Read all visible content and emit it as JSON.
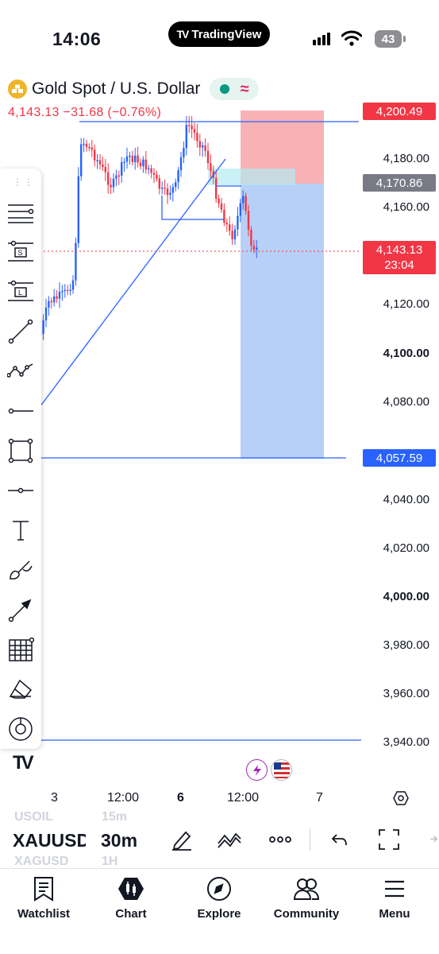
{
  "status_bar": {
    "time": "14:06",
    "app_pill": "TradingView",
    "battery": "43"
  },
  "symbol": {
    "name": "Gold Spot / U.S. Dollar",
    "price_change": "4,143.13  −31.68 (−0.76%)"
  },
  "price_axis": {
    "labels": [
      {
        "text": "4,180.00",
        "bold": false
      },
      {
        "text": "4,160.00",
        "bold": false
      },
      {
        "text": "4,120.00",
        "bold": false
      },
      {
        "text": "4,100.00",
        "bold": true
      },
      {
        "text": "4,080.00",
        "bold": false
      },
      {
        "text": "4,040.00",
        "bold": false
      },
      {
        "text": "4,020.00",
        "bold": false
      },
      {
        "text": "4,000.00",
        "bold": true
      },
      {
        "text": "3,980.00",
        "bold": false
      },
      {
        "text": "3,960.00",
        "bold": false
      },
      {
        "text": "3,940.00",
        "bold": false
      }
    ],
    "stop_loss_tag": "4,200.49",
    "entry_tag": "4,170.86",
    "take_profit_tag": "4,057.59",
    "current_price": "4,143.13",
    "countdown": "23:04"
  },
  "colors": {
    "up": "#2962ff",
    "down": "#f23645",
    "loss_zone": "#f7a4a9",
    "profit_zone": "#b3cef7",
    "line": "#2962ff"
  },
  "time_axis": {
    "labels": [
      "3",
      "12:00",
      "6",
      "12:00",
      "7"
    ]
  },
  "controls": {
    "ghost_symbol_above": "USOIL",
    "ghost_interval_above": "15m",
    "symbol": "XAUUSD",
    "interval": "30m",
    "ghost_symbol_below": "XAGUSD",
    "ghost_interval_below": "1H"
  },
  "bottom_nav": {
    "items": [
      {
        "label": "Watchlist",
        "icon": "watchlist-icon"
      },
      {
        "label": "Chart",
        "icon": "chart-icon"
      },
      {
        "label": "Explore",
        "icon": "compass-icon"
      },
      {
        "label": "Community",
        "icon": "people-icon"
      },
      {
        "label": "Menu",
        "icon": "hamburger-icon"
      }
    ]
  }
}
